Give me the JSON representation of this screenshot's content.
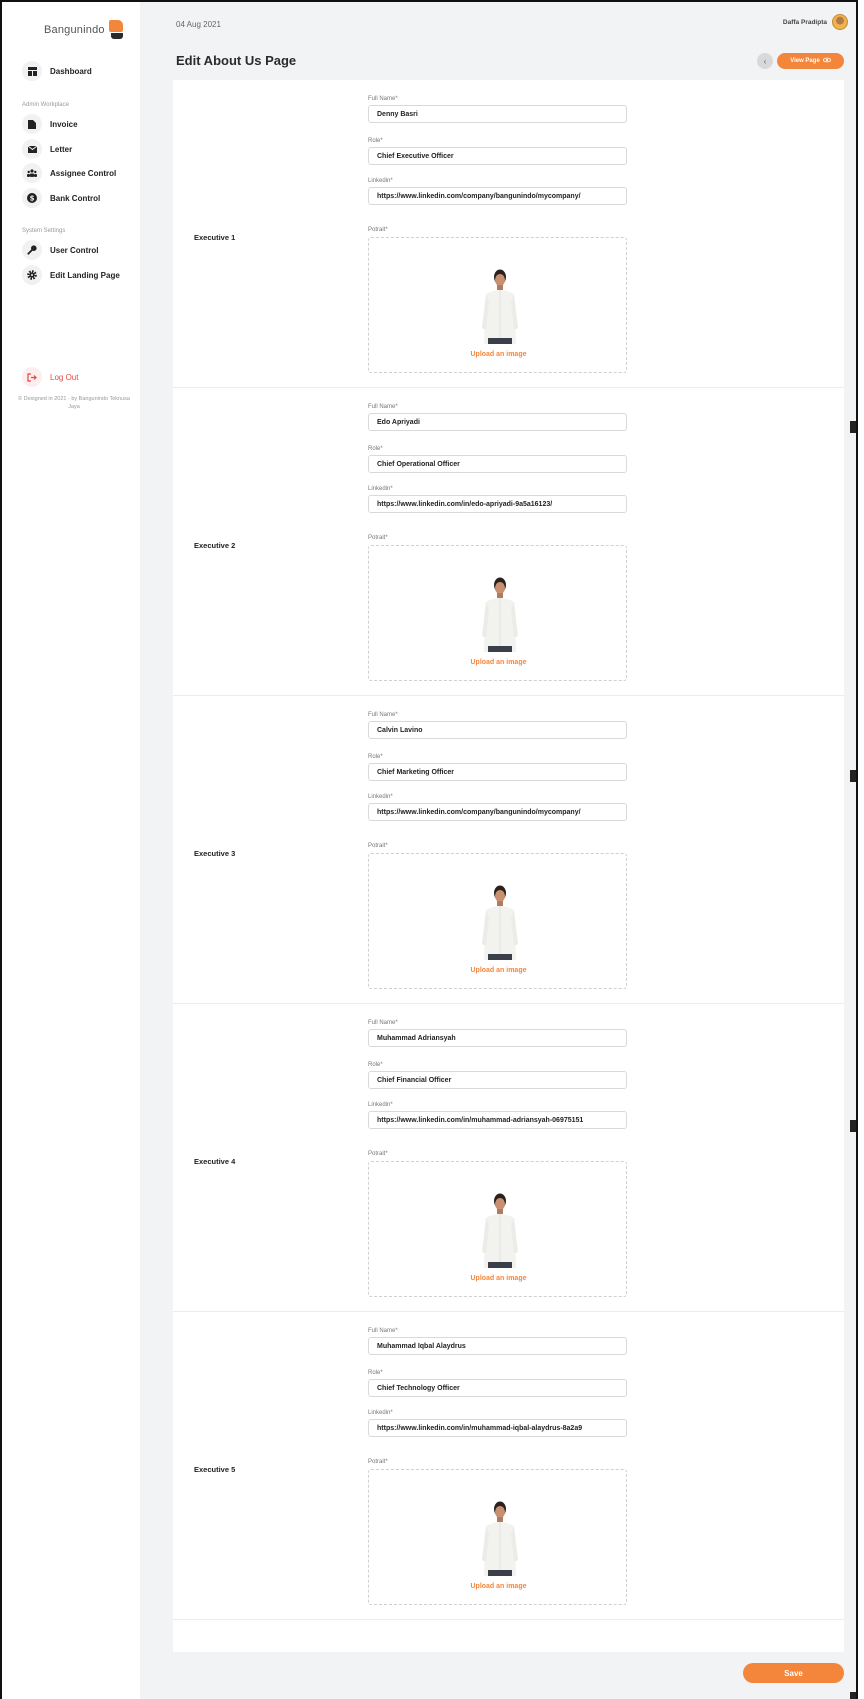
{
  "header": {
    "brand": "Bangunindo",
    "date": "04 Aug 2021",
    "user_name": "Daffa Pradipta"
  },
  "sidebar": {
    "dashboard": "Dashboard",
    "admin_section": "Admin Workplace",
    "admin_items": [
      "Invoice",
      "Letter",
      "Assignee Control",
      "Bank Control"
    ],
    "system_section": "System Settings",
    "system_items": [
      "User Control",
      "Edit Landing Page"
    ],
    "logout": "Log Out",
    "credit": "© Designed in 2021 - by Bangunindo Teknusa Jaya"
  },
  "page": {
    "title": "Edit About Us Page",
    "view_page": "View Page",
    "save": "Save"
  },
  "form_labels": {
    "full_name": "Full Name*",
    "role": "Role*",
    "linkedin": "Linkedin*",
    "portrait": "Potrait*",
    "upload": "Upload an image"
  },
  "executives": [
    {
      "label": "Executive 1",
      "full_name": "Denny Basri",
      "role": "Chief Executive Officer",
      "linkedin": "https://www.linkedin.com/company/bangunindo/mycompany/"
    },
    {
      "label": "Executive 2",
      "full_name": "Edo Apriyadi",
      "role": "Chief Operational Officer",
      "linkedin": "https://www.linkedin.com/in/edo-apriyadi-9a5a16123/"
    },
    {
      "label": "Executive 3",
      "full_name": "Calvin Lavino",
      "role": "Chief Marketing Officer",
      "linkedin": "https://www.linkedin.com/company/bangunindo/mycompany/"
    },
    {
      "label": "Executive 4",
      "full_name": "Muhammad Adriansyah",
      "role": "Chief Financial Officer",
      "linkedin": "https://www.linkedin.com/in/muhammad-adriansyah-06975151"
    },
    {
      "label": "Executive 5",
      "full_name": "Muhammad Iqbal Alaydrus",
      "role": "Chief Technology Officer",
      "linkedin": "https://www.linkedin.com/in/muhammad-iqbal-alaydrus-8a2a9"
    }
  ],
  "colors": {
    "accent": "#f4863b",
    "logout": "#e04848",
    "background": "#f2f3f5"
  }
}
